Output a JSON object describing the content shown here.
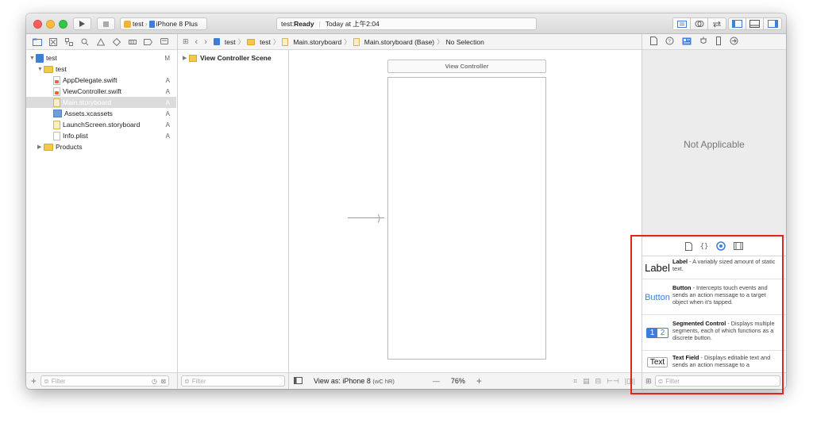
{
  "toolbar": {
    "scheme_name": "test",
    "device_name": "iPhone 8 Plus",
    "activity_project": "test: ",
    "activity_status": "Ready",
    "activity_time": "Today at 上午2:04"
  },
  "navigator": {
    "items": [
      {
        "label": "test",
        "badge": "M"
      },
      {
        "label": "test",
        "badge": ""
      },
      {
        "label": "AppDelegate.swift",
        "badge": "A"
      },
      {
        "label": "ViewController.swift",
        "badge": "A"
      },
      {
        "label": "Main.storyboard",
        "badge": "A"
      },
      {
        "label": "Assets.xcassets",
        "badge": "A"
      },
      {
        "label": "LaunchScreen.storyboard",
        "badge": "A"
      },
      {
        "label": "Info.plist",
        "badge": "A"
      },
      {
        "label": "Products",
        "badge": ""
      }
    ],
    "filter_placeholder": "Filter"
  },
  "jumpbar": {
    "crumbs": [
      "test",
      "test",
      "Main.storyboard",
      "Main.storyboard (Base)",
      "No Selection"
    ]
  },
  "outline": {
    "scene_label": "View Controller Scene",
    "filter_placeholder": "Filter"
  },
  "canvas": {
    "vc_title": "View Controller",
    "view_as": "View as: iPhone 8",
    "size_class": "(wC hR)",
    "zoom_minus": "—",
    "zoom": "76%",
    "zoom_plus": "+"
  },
  "inspector": {
    "empty_text": "Not Applicable"
  },
  "library": {
    "items": [
      {
        "glyph": "Label",
        "title": "Label",
        "desc": " - A variably sized amount of static text."
      },
      {
        "glyph": "Button",
        "title": "Button",
        "desc": " - Intercepts touch events and sends an action message to a target object when it's tapped."
      },
      {
        "glyph_1": "1",
        "glyph_2": "2",
        "title": "Segmented Control",
        "desc": " - Displays multiple segments, each of which functions as a discrete button."
      },
      {
        "glyph": "Text",
        "title": "Text Field",
        "desc": " - Displays editable text and sends an action message to a"
      }
    ],
    "filter_placeholder": "Filter"
  },
  "colors": {
    "accent": "#3d7fd8",
    "highlight_box": "#e0251b"
  }
}
